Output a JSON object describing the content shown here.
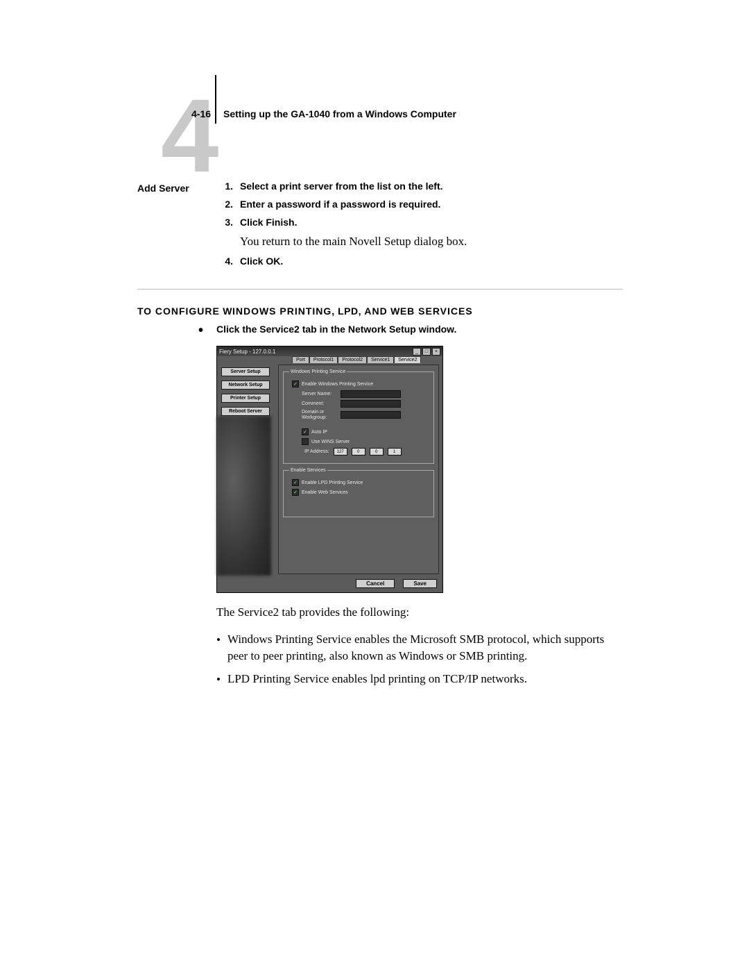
{
  "header": {
    "chapter_digit": "4",
    "page_num": "4-16",
    "chapter_title": "Setting up the GA-1040 from a Windows Computer"
  },
  "margin_label": "Add Server",
  "steps": [
    {
      "n": "1.",
      "text": "Select a print server from the list on the left."
    },
    {
      "n": "2.",
      "text": "Enter a password if a password is required."
    },
    {
      "n": "3.",
      "text": "Click Finish."
    },
    {
      "n": "",
      "body": "You return to the main Novell Setup dialog box."
    },
    {
      "n": "4.",
      "text": "Click OK."
    }
  ],
  "section_title_pre": "T",
  "section_title_sc": "O CONFIGURE",
  "section_title_mid1": " W",
  "section_title_sc2": "INDOWS PRINTING",
  "section_title_mid2": ", LPD, ",
  "section_title_sc3": "AND",
  "section_title_mid3": " W",
  "section_title_sc4": "EB SERVICES",
  "bullet_line": "Click the Service2 tab in the Network Setup window.",
  "dialog": {
    "title": "Fiery Setup - 127.0.0.1",
    "win_btn_min": "_",
    "win_btn_max": "□",
    "win_btn_close": "×",
    "tabs": [
      "Port",
      "Protocol1",
      "Protocol2",
      "Service1",
      "Service2"
    ],
    "sidebar": [
      "Server Setup",
      "Network Setup",
      "Printer Setup",
      "Reboot Server"
    ],
    "group1": {
      "legend": "Windows Printing Service",
      "enable": "Enable Windows Printing Service",
      "server_name": "Server Name:",
      "comment": "Comment:",
      "domain": "Domain or Workgroup:",
      "auto_ip": "Auto IP",
      "use_wins": "Use WINS Server",
      "ip_label": "IP Address:",
      "ip": [
        "127",
        "0",
        "0",
        "1"
      ]
    },
    "group2": {
      "legend": "Enable Services",
      "lpd": "Enable LPD Printing Service",
      "web": "Enable Web Services"
    },
    "cancel": "Cancel",
    "save": "Save"
  },
  "post_intro": "The Service2 tab provides the following:",
  "post_bullets": [
    "Windows Printing Service enables the Microsoft SMB protocol, which supports peer to peer printing, also known as Windows or SMB printing.",
    "LPD Printing Service enables lpd printing on TCP/IP networks."
  ]
}
